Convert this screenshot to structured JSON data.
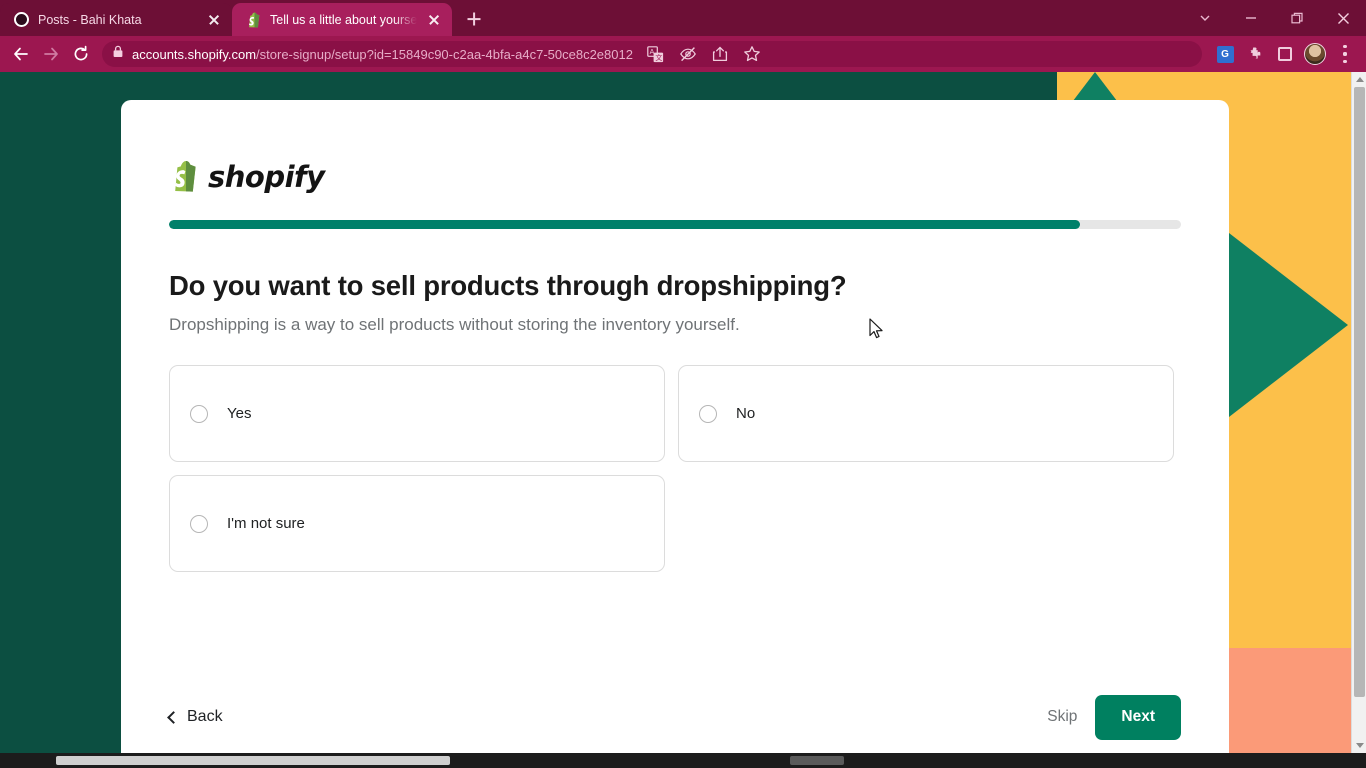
{
  "browser": {
    "tabs": [
      {
        "title": "Posts - Bahi Khata",
        "favicon": "circle-ring-icon",
        "active": false
      },
      {
        "title": "Tell us a little about yourself — S",
        "favicon": "shopify-bag-icon",
        "active": true
      }
    ],
    "new_tab_label": "+",
    "window_controls": [
      "tab-search-chevron",
      "minimize",
      "restore",
      "close"
    ],
    "nav": {
      "back": "back-arrow",
      "forward": "forward-arrow",
      "reload": "reload-arrow",
      "lock": "lock-icon"
    },
    "url": {
      "host": "accounts.shopify.com",
      "path": "/store-signup/setup?id=15849c90-c2aa-4bfa-a4c7-50ce8c2e8012"
    },
    "toolbar_icons": [
      "translate-icon",
      "eye-slash-icon",
      "share-icon",
      "bookmark-star-icon",
      "google-translate-extension-icon",
      "extensions-puzzle-icon",
      "side-panel-icon",
      "profile-avatar-icon",
      "chrome-menu-kebab-icon"
    ]
  },
  "page": {
    "logo": {
      "wordmark": "shopify",
      "bag_letter": "S"
    },
    "progress": {
      "percent": 90,
      "fill_color": "#00806a",
      "track_color": "#e6e6e6"
    },
    "heading": "Do you want to sell products through dropshipping?",
    "subheading": "Dropshipping is a way to sell products without storing the inventory yourself.",
    "options": [
      {
        "label": "Yes",
        "selected": false
      },
      {
        "label": "No",
        "selected": false
      },
      {
        "label": "I'm not sure",
        "selected": false
      }
    ],
    "footer": {
      "back_label": "Back",
      "skip_label": "Skip",
      "next_label": "Next"
    }
  },
  "theme": {
    "chrome_magenta": "#9c1750",
    "title_magenta": "#6d0f36",
    "active_tab": "#a81f5d",
    "page_dark_green": "#0c4f41",
    "accent_green": "#008060",
    "shape_green": "#0f8062",
    "shape_yellow": "#fcc04a",
    "shape_peach": "#fb9a78"
  }
}
